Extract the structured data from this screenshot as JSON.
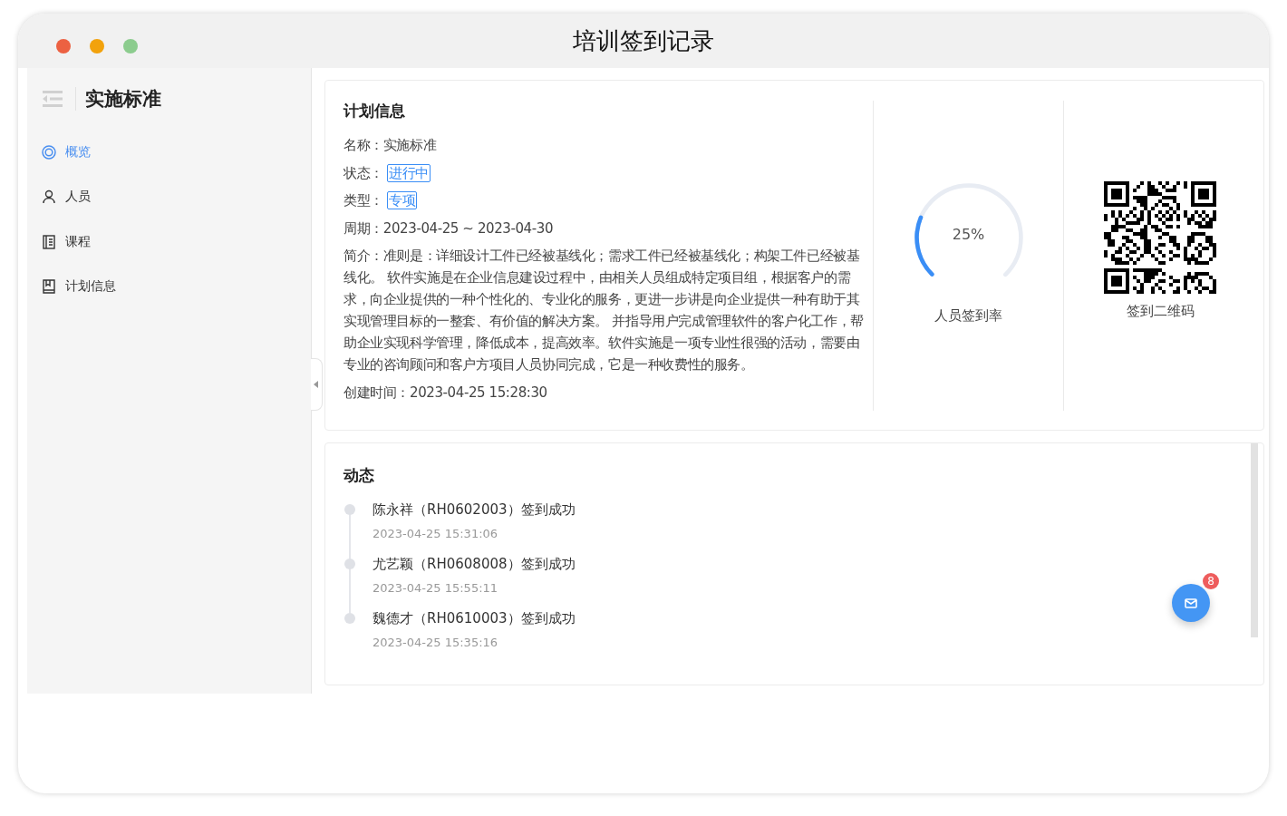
{
  "window": {
    "title": "培训签到记录"
  },
  "sidebar": {
    "title": "实施标准",
    "items": [
      {
        "label": "概览",
        "kind": "overview",
        "selected": true
      },
      {
        "label": "人员",
        "kind": "people",
        "selected": false
      },
      {
        "label": "课程",
        "kind": "course",
        "selected": false
      },
      {
        "label": "计划信息",
        "kind": "plan",
        "selected": false
      }
    ]
  },
  "plan": {
    "title": "计划信息",
    "fields": [
      {
        "label": "名称：",
        "value": "实施标准",
        "kind": "text"
      },
      {
        "label": "状态：",
        "value": "进行中",
        "kind": "tag"
      },
      {
        "label": "类型：",
        "value": "专项",
        "kind": "tag"
      },
      {
        "label": "周期：",
        "value": "2023-04-25 ~ 2023-04-30",
        "kind": "text"
      },
      {
        "label": "简介：",
        "value": "准则是：详细设计工件已经被基线化；需求工件已经被基线化；构架工件已经被基线化。 软件实施是在企业信息建设过程中，由相关人员组成特定项目组，根据客户的需求，向企业提供的一种个性化的、专业化的服务，更进一步讲是向企业提供一种有助于其实现管理目标的一整套、有价值的解决方案。 并指导用户完成管理软件的客户化工作，帮助企业实现科学管理，降低成本，提高效率。软件实施是一项专业性很强的活动，需要由专业的咨询顾问和客户方项目人员协同完成，它是一种收费性的服务。",
        "kind": "text"
      },
      {
        "label": "创建时间：",
        "value": "2023-04-25 15:28:30",
        "kind": "text"
      }
    ]
  },
  "rate": {
    "reading": "25%",
    "level": 0.25,
    "label": "人员签到率"
  },
  "qr": {
    "label": "签到二维码"
  },
  "activity": {
    "title": "动态",
    "items": [
      {
        "text": "陈永祥（RH0602003）签到成功",
        "time": "2023-04-25 15:31:06"
      },
      {
        "text": "尤艺颖（RH0608008）签到成功",
        "time": "2023-04-25 15:55:11"
      },
      {
        "text": "魏德才（RH0610003）签到成功",
        "time": "2023-04-25 15:35:16"
      }
    ]
  },
  "message_button": {
    "badge": "8"
  }
}
